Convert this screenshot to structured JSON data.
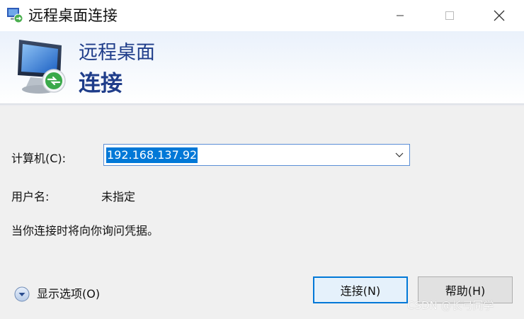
{
  "window": {
    "title": "远程桌面连接",
    "controls": [
      "minimize-icon",
      "maximize-icon",
      "close-icon"
    ]
  },
  "banner": {
    "line1": "远程桌面",
    "line2": "连接",
    "icon": "remote-desktop-monitor-icon"
  },
  "form": {
    "computer_label": "计算机(C):",
    "computer_value": "192.168.137.92",
    "username_label": "用户名:",
    "username_value": "未指定",
    "credential_note": "当你连接时将向你询问凭据。"
  },
  "footer": {
    "show_options_label": "显示选项(O)",
    "connect_label": "连接(N)",
    "help_label": "帮助(H)"
  },
  "watermark": "CSDN @长弓同学",
  "colors": {
    "accent": "#0078d7",
    "banner_text": "#1f3d8a",
    "window_bg": "#f0f0f0"
  }
}
